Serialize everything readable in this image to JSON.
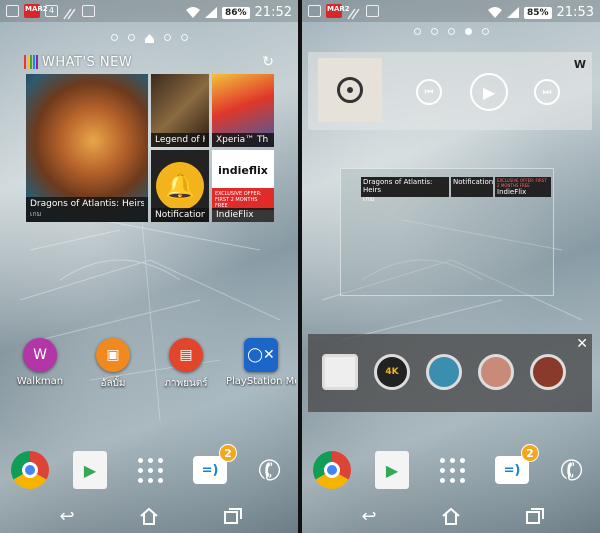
{
  "left": {
    "status": {
      "operator_badge": "MAR2",
      "notif_count": "4",
      "battery": "86%",
      "time": "21:52"
    },
    "whats_new": {
      "title": "WHAT'S NEW",
      "tiles": [
        {
          "title": "Dragons of Atlantis: Heirs",
          "subtitle": "เกม"
        },
        {
          "title": "Legend of H"
        },
        {
          "title": "Xperia™ Th"
        },
        {
          "title": "Notification"
        },
        {
          "title": "IndieFlix",
          "logo": "indieflix",
          "banner": "EXCLUSIVE OFFER: FIRST 2 MONTHS FREE"
        }
      ]
    },
    "apps": [
      {
        "label": "Walkman",
        "icon": "walkman-icon",
        "color": "#b335a8"
      },
      {
        "label": "อัลบั้ม",
        "icon": "album-icon",
        "color": "#f08a1f"
      },
      {
        "label": "ภาพยนตร์",
        "icon": "movies-icon",
        "color": "#e2452a"
      },
      {
        "label": "PlayStation Mo",
        "icon": "playstation-icon",
        "color": "#1b66c8"
      }
    ],
    "dock": {
      "message_badge": "2"
    }
  },
  "right": {
    "status": {
      "operator_badge": "MAR2",
      "battery": "85%",
      "time": "21:53"
    },
    "player": {
      "logo": "W"
    },
    "mini_widget": {
      "tiles": [
        {
          "title": "Dragons of Atlantis: Heirs",
          "subtitle": "เกม"
        },
        {
          "title": "Notification"
        },
        {
          "title": "IndieFlix",
          "banner": "EXCLUSIVE OFFER: FIRST 2 MONTHS FREE"
        }
      ]
    },
    "tray": {
      "label_4k": "4K"
    },
    "dock": {
      "message_badge": "2"
    }
  },
  "colors": {
    "bell": "#f2b31c",
    "badge": "#f4a71c",
    "indie_red": "#e02b2b"
  }
}
